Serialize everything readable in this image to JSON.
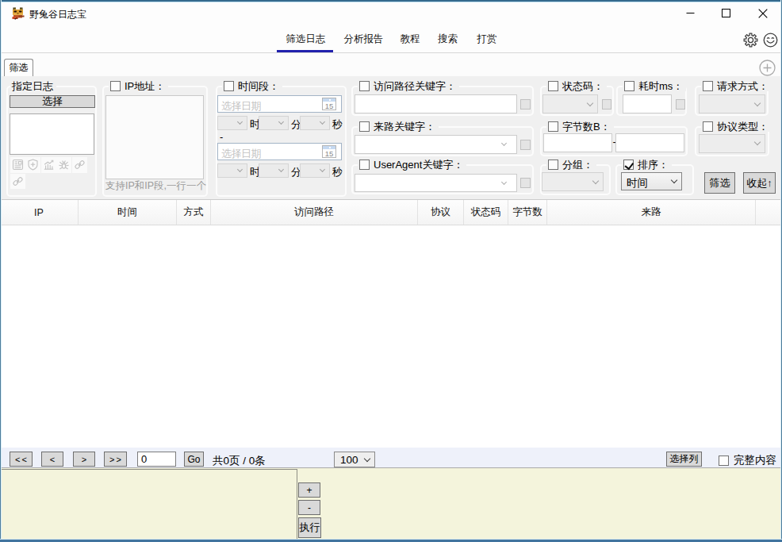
{
  "window": {
    "title": "野兔谷日志宝",
    "controls": {
      "minimize": "minimize",
      "maximize": "maximize",
      "close": "close"
    }
  },
  "menu": {
    "items": [
      {
        "label": "筛选日志",
        "active": true
      },
      {
        "label": "分析报告",
        "active": false
      },
      {
        "label": "教程",
        "active": false
      },
      {
        "label": "搜索",
        "active": false
      },
      {
        "label": "打赏",
        "active": false
      }
    ],
    "icons": [
      "settings-gear",
      "smiley-face"
    ]
  },
  "tabstrip": {
    "filter_tab": "筛选",
    "add_tab_icon": "plus-circle"
  },
  "filter": {
    "log_group": {
      "title": "指定日志",
      "select_button": "选择",
      "icon_names": [
        "log-card",
        "shield-plus",
        "chart-bars",
        "spider",
        "link",
        "link"
      ]
    },
    "ip_group": {
      "label": "IP地址：",
      "checked": false,
      "hint": "支持IP和IP段,一行一个"
    },
    "time_group": {
      "label": "时间段：",
      "checked": false,
      "date_placeholder": "选择日期",
      "calendar_day": "15",
      "hour_label": "时",
      "minute_label": "分",
      "second_label": "秒",
      "range_separator": "-"
    },
    "path_group": {
      "label": "访问路径关键字：",
      "checked": false
    },
    "referer_group": {
      "label": "来路关键字：",
      "checked": false
    },
    "useragent_group": {
      "label": "UserAgent关键字：",
      "checked": false
    },
    "status_group": {
      "label": "状态码：",
      "checked": false
    },
    "elapsed_group": {
      "label": "耗时ms：",
      "checked": false
    },
    "method_group": {
      "label": "请求方式：",
      "checked": false
    },
    "bytes_group": {
      "label": "字节数B：",
      "checked": false,
      "range_separator": "-"
    },
    "protocol_group": {
      "label": "协议类型：",
      "checked": false
    },
    "grouping_group": {
      "label": "分组：",
      "checked": false
    },
    "sort_group": {
      "label": "排序：",
      "checked": true,
      "value": "时间"
    },
    "filter_button": "筛选",
    "collapse_button": "收起↑"
  },
  "table": {
    "columns": [
      "IP",
      "时间",
      "方式",
      "访问路径",
      "协议",
      "状态码",
      "字节数",
      "来路"
    ],
    "rows": []
  },
  "pagination": {
    "first": "<<",
    "prev": "<",
    "next": ">",
    "last": ">>",
    "page_value": "0",
    "go": "Go",
    "summary": "共0页 / 0条",
    "page_size": "100",
    "select_columns": "选择列",
    "full_content": "完整内容",
    "full_content_checked": false
  },
  "footer": {
    "add": "+",
    "subtract": "-",
    "execute": "执行"
  },
  "colors": {
    "accent_underline": "#2121ad",
    "window_border": "#4e7d9b",
    "panel_bg": "#f0f0f0",
    "pagebar_bg": "#eef1fa",
    "footer_bg": "#f4f4dc"
  }
}
